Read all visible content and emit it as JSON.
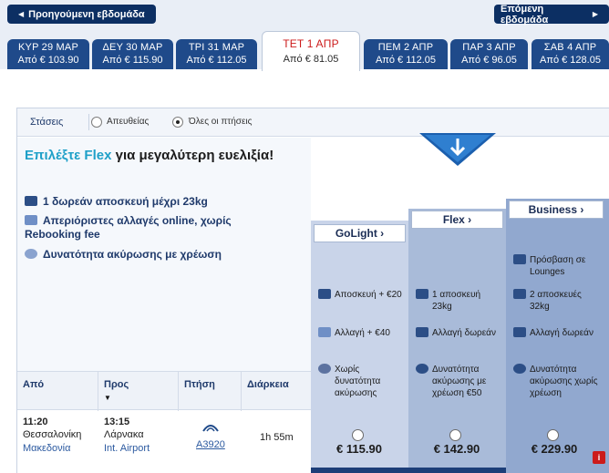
{
  "nav": {
    "prev_week": "Προηγούμενη εβδομάδα",
    "next_week": "Επόμενη εβδομάδα"
  },
  "tabs": [
    {
      "date": "ΚΥΡ 29 ΜΑΡ",
      "price": "Από  € 103.90"
    },
    {
      "date": "ΔΕΥ 30 ΜΑΡ",
      "price": "Από  € 115.90"
    },
    {
      "date": "ΤΡΙ 31 ΜΑΡ",
      "price": "Από  € 112.05"
    },
    {
      "date": "ΤΕΤ 1 ΑΠΡ",
      "price": "Από  € 81.05"
    },
    {
      "date": "ΠΕΜ 2 ΑΠΡ",
      "price": "Από  € 112.05"
    },
    {
      "date": "ΠΑΡ 3 ΑΠΡ",
      "price": "Από  € 96.05"
    },
    {
      "date": "ΣΑΒ 4 ΑΠΡ",
      "price": "Από  € 128.05"
    }
  ],
  "stops": {
    "label": "Στάσεις",
    "direct": "Απευθείας",
    "all": "Όλες οι πτήσεις"
  },
  "promo": {
    "title_hl": "Επιλέξτε Flex",
    "title_rest": " για μεγαλύτερη ευελιξία!",
    "perk1": "1 δωρεάν αποσκευή μέχρι 23kg",
    "perk2": "Απεριόριστες αλλαγές online, χωρίς Rebooking fee",
    "perk3": "Δυνατότητα ακύρωσης με χρέωση"
  },
  "table": {
    "from": "Από",
    "to": "Προς",
    "flight": "Πτήση",
    "duration": "Διάρκεια"
  },
  "flight": {
    "dep_time": "11:20",
    "dep_city": "Θεσσαλονίκη",
    "dep_sub": "Μακεδονία",
    "arr_time": "13:15",
    "arr_city": "Λάρνακα",
    "arr_sub": "Int. Airport",
    "number": "A3920",
    "duration": "1h 55m"
  },
  "fares": {
    "golight": {
      "name": "GoLight",
      "f1": "Αποσκευή + €20",
      "f2": "Αλλαγή + €40",
      "f3": "Χωρίς δυνατότητα ακύρωσης",
      "price": "€ 115.90"
    },
    "flex": {
      "name": "Flex",
      "f1": "1 αποσκευή 23kg",
      "f2": "Αλλαγή δωρεάν",
      "f3": "Δυνατότητα ακύρωσης με χρέωση €50",
      "price": "€ 142.90"
    },
    "business": {
      "name": "Business",
      "f0": "Πρόσβαση σε Lounges",
      "f1": "2 αποσκευές 32kg",
      "f2": "Αλλαγή δωρεάν",
      "f3": "Δυνατότητα ακύρωσης χωρίς χρέωση",
      "price": "€ 229.90"
    }
  },
  "colors": {
    "navy": "#0c2f63",
    "tab": "#1f4a8a",
    "accent_red": "#cc1b1b",
    "flex_blue": "#1fa0c8",
    "col_light": "#c7d3e8",
    "col_mid": "#a9bbd9",
    "col_dark": "#91a8cf"
  }
}
